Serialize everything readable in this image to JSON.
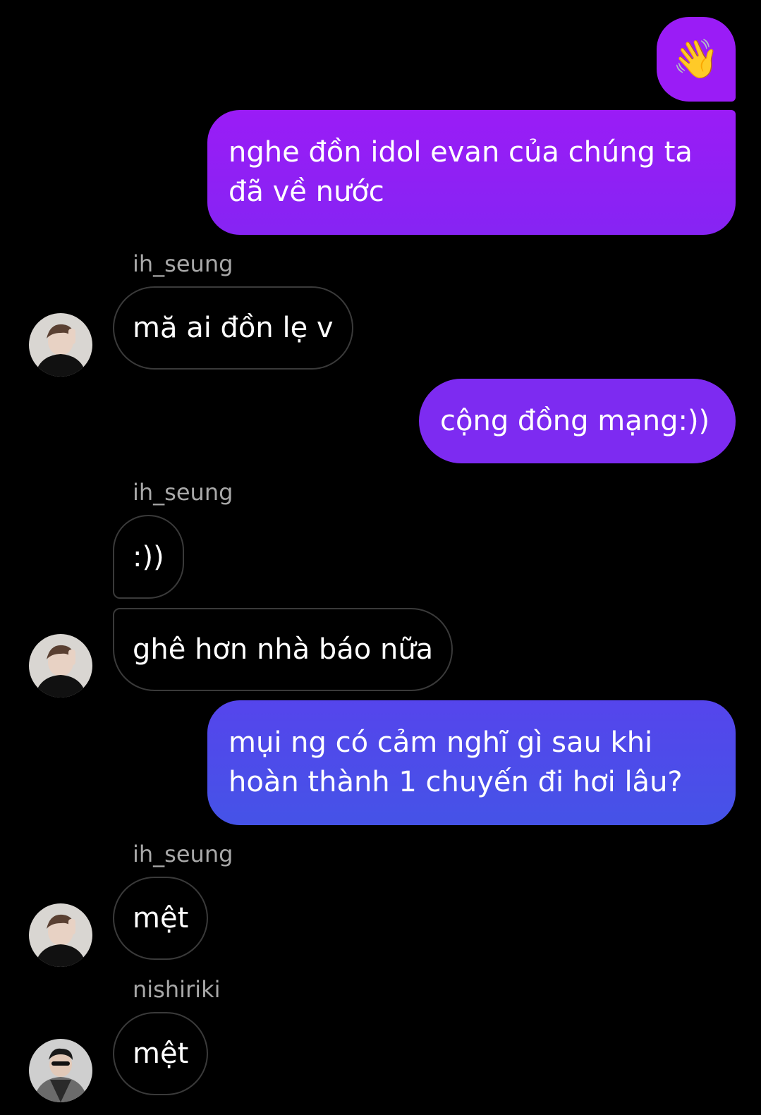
{
  "colors": {
    "bubble_out_top": "#9a1cf6",
    "bubble_out_mid": "#7d2bf1",
    "bubble_out_mid2": "#6d33ef",
    "bubble_out_bottom": "#4553e7",
    "bubble_in_border": "#3a3a3a",
    "sender_text": "#a8a8a8",
    "background": "#000000"
  },
  "messages": [
    {
      "type": "outgoing-emoji",
      "icon": "waving-hand-icon",
      "text": "👋"
    },
    {
      "type": "outgoing",
      "text": "nghe đồn idol evan của chúng ta đã về nước"
    },
    {
      "type": "sender",
      "text": "ih_seung"
    },
    {
      "type": "incoming",
      "avatar": "avatar-ih-seung",
      "text": "mă ai đồn lẹ v"
    },
    {
      "type": "outgoing",
      "text": "cộng đồng mạng:))"
    },
    {
      "type": "sender",
      "text": "ih_seung"
    },
    {
      "type": "incoming",
      "text": ":))"
    },
    {
      "type": "incoming",
      "avatar": "avatar-ih-seung",
      "text": "ghê hơn nhà báo nữa"
    },
    {
      "type": "outgoing",
      "text": "mụi ng có cảm nghĩ gì sau khi hoàn thành 1 chuyến đi hơi lâu?"
    },
    {
      "type": "sender",
      "text": "ih_seung"
    },
    {
      "type": "incoming",
      "avatar": "avatar-ih-seung",
      "text": "mệt"
    },
    {
      "type": "sender",
      "text": "nishiriki"
    },
    {
      "type": "incoming",
      "avatar": "avatar-nishiriki",
      "text": "mệt"
    }
  ]
}
